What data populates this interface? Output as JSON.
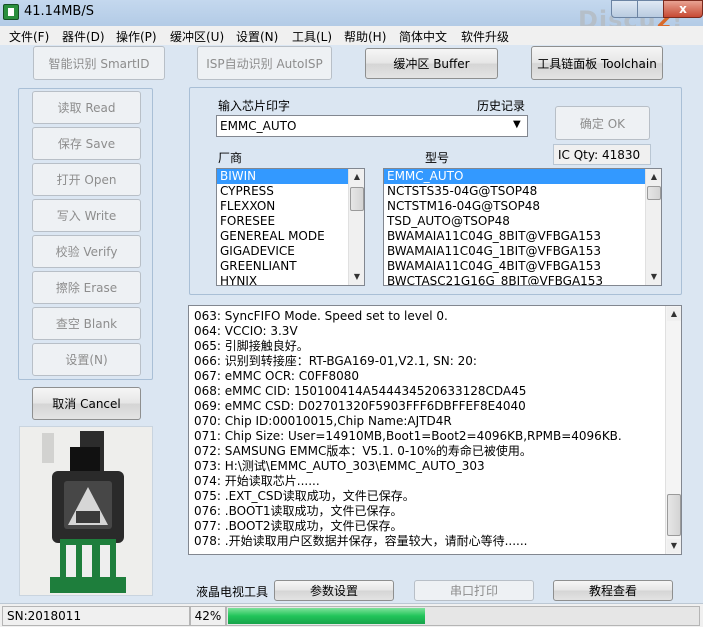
{
  "window": {
    "title": "41.14MB/S",
    "watermark": "Discuz!",
    "close_glyph": "x"
  },
  "menu": [
    "文件(F)",
    "器件(D)",
    "操作(P)",
    "缓冲区(U)",
    "设置(N)",
    "工具(L)",
    "帮助(H)",
    "简体中文",
    "软件升级"
  ],
  "toolbar": {
    "smart_id": "智能识别 SmartID",
    "isp_auto": "ISP自动识别 AutoISP",
    "buffer": "缓冲区 Buffer",
    "toolchain": "工具链面板 Toolchain"
  },
  "ops": [
    "读取 Read",
    "保存 Save",
    "打开 Open",
    "写入 Write",
    "校验 Verify",
    "擦除 Erase",
    "查空 Blank",
    "设置(N)"
  ],
  "cancel_label": "取消 Cancel",
  "chip": {
    "input_label": "输入芯片印字",
    "history_label": "历史记录",
    "value": "EMMC_AUTO",
    "ok_label": "确定 OK",
    "ic_qty": "IC Qty: 41830",
    "vendor_label": "厂商",
    "model_label": "型号"
  },
  "vendors": [
    "BIWIN",
    "CYPRESS",
    "FLEXXON",
    "FORESEE",
    "GENEREAL MODE",
    "GIGADEVICE",
    "GREENLIANT",
    "HYNIX"
  ],
  "models": [
    "EMMC_AUTO",
    "NCTSTS35-04G@TSOP48",
    "NCTSTM16-04G@TSOP48",
    "TSD_AUTO@TSOP48",
    "BWAMAIA11C04G_8BIT@VFBGA153",
    "BWAMAIA11C04G_1BIT@VFBGA153",
    "BWAMAIA11C04G_4BIT@VFBGA153",
    "BWCTASC21G16G_8BIT@VFBGA153"
  ],
  "log": [
    "063:  SyncFIFO Mode. Speed set to level 0.",
    "064:  VCCIO: 3.3V",
    "065:  引脚接触良好。",
    "066:  识别到转接座：RT-BGA169-01,V2.1, SN: 20:",
    "067:  eMMC OCR: C0FF8080",
    "068:  eMMC CID:  150100414A544434520633128CDA45",
    "069:  eMMC CSD: D02701320F5903FFF6DBFFEF8E4040",
    "070:  Chip ID:00010015,Chip Name:AJTD4R",
    "071:  Chip Size: User=14910MB,Boot1=Boot2=4096KB,RPMB=4096KB.",
    "072:  SAMSUNG EMMC版本：V5.1.   0-10%的寿命已被使用。",
    "073:  H:\\测试\\EMMC_AUTO_303\\EMMC_AUTO_303",
    "074:  开始读取芯片......",
    "075:  .EXT_CSD读取成功，文件已保存。",
    "076:  .BOOT1读取成功，文件已保存。",
    "077:  .BOOT2读取成功，文件已保存。",
    "078:  .开始读取用户区数据并保存，容量较大，请耐心等待......"
  ],
  "bottom": {
    "lcd_tool": "液晶电视工具",
    "params": "参数设置",
    "serial_print": "串口打印",
    "tutorial": "教程查看"
  },
  "status": {
    "sn": "SN:2018011",
    "progress_text": "42%",
    "progress": 0.42
  },
  "colors": {
    "accent": "#3399ff",
    "progress": "#21c45a"
  },
  "icons": {
    "app": "programmer-icon",
    "adapter": "bga-socket-adapter-photo"
  }
}
